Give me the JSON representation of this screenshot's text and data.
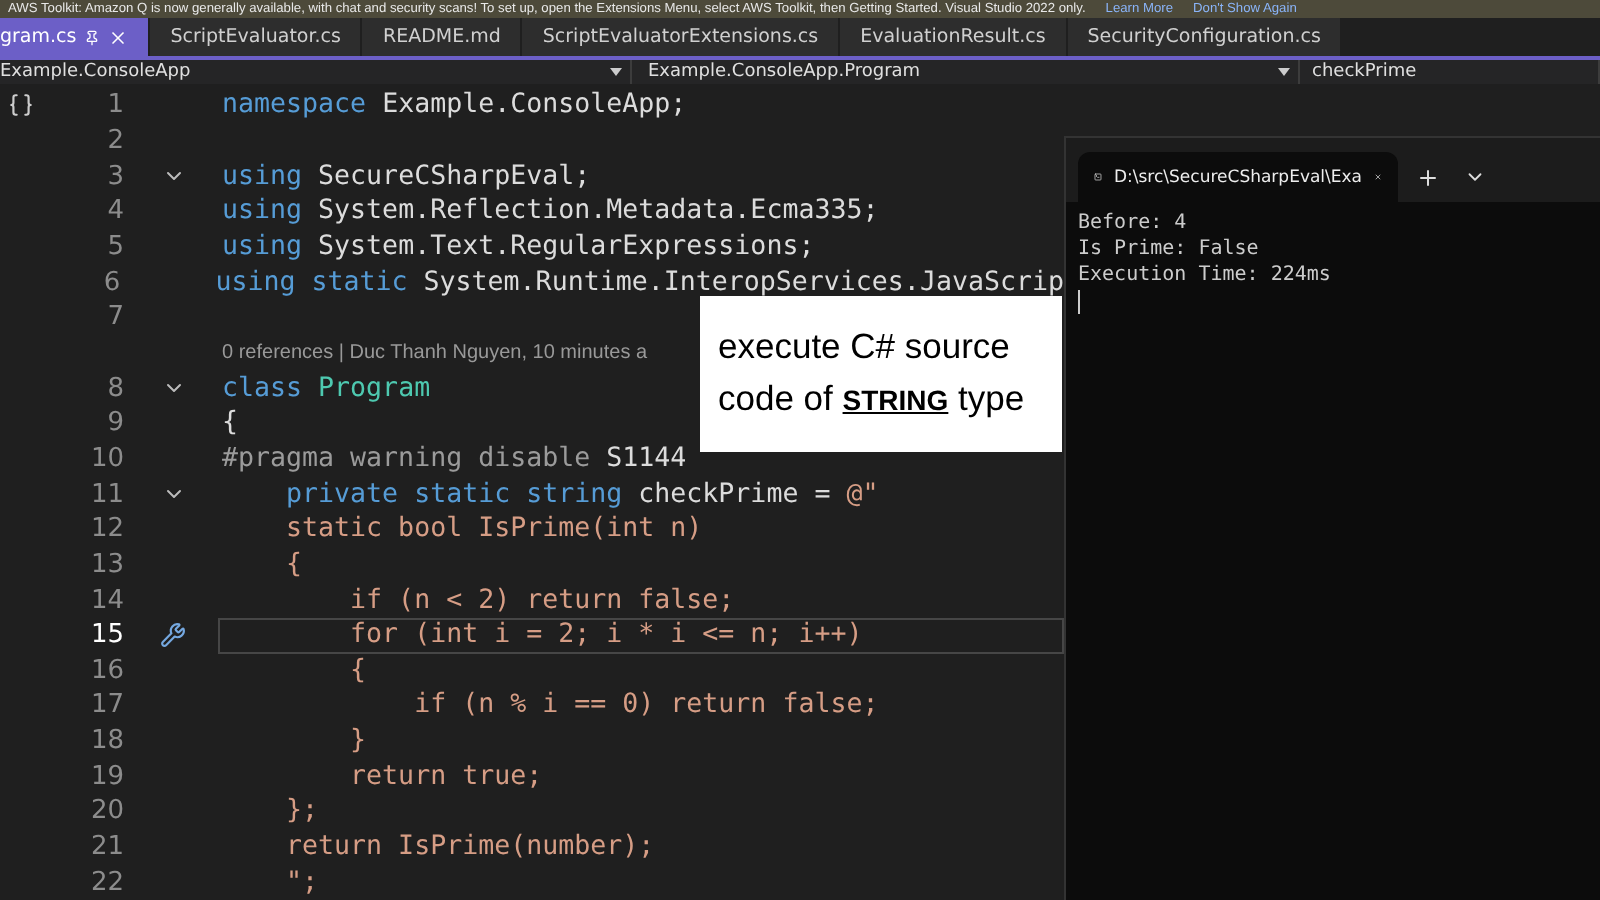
{
  "info_bar": {
    "message": "AWS Toolkit: Amazon Q is now generally available, with chat and security scans! To set up, open the Extensions Menu, select AWS Toolkit, then Getting Started. Visual Studio 2022 only.",
    "links": [
      "Learn More",
      "Don't Show Again"
    ]
  },
  "tabs": [
    {
      "label": "gram.cs",
      "selected": true,
      "pinned": true
    },
    {
      "label": "ScriptEvaluator.cs",
      "selected": false,
      "pinned": false
    },
    {
      "label": "README.md",
      "selected": false,
      "pinned": false
    },
    {
      "label": "ScriptEvaluatorExtensions.cs",
      "selected": false,
      "pinned": false
    },
    {
      "label": "EvaluationResult.cs",
      "selected": false,
      "pinned": false
    },
    {
      "label": "SecurityConfiguration.cs",
      "selected": false,
      "pinned": false
    }
  ],
  "nav_bar": {
    "project": "Example.ConsoleApp",
    "type": "Example.ConsoleApp.Program",
    "member": "checkPrime"
  },
  "editor": {
    "lines": [
      {
        "kind": "code",
        "number": "1",
        "fold": false,
        "current": false,
        "tokens": [
          {
            "kind": "keyword",
            "s": "namespace"
          },
          {
            "kind": "plain",
            "s": " Example.ConsoleApp;"
          }
        ]
      },
      {
        "kind": "code",
        "number": "2",
        "fold": false,
        "current": false
      },
      {
        "kind": "code",
        "number": "3",
        "fold": true,
        "current": false,
        "tokens": [
          {
            "kind": "keyword",
            "s": "using"
          },
          {
            "kind": "plain",
            "s": " SecureCSharpEval;"
          }
        ]
      },
      {
        "kind": "code",
        "number": "4",
        "fold": false,
        "current": false,
        "tokens": [
          {
            "kind": "keyword",
            "s": "using"
          },
          {
            "kind": "plain",
            "s": " System.Reflection.Metadata.Ecma335;"
          }
        ]
      },
      {
        "kind": "code",
        "number": "5",
        "fold": false,
        "current": false,
        "tokens": [
          {
            "kind": "keyword",
            "s": "using"
          },
          {
            "kind": "plain",
            "s": " System.Text.RegularExpressions;"
          }
        ]
      },
      {
        "kind": "code",
        "number": "6",
        "fold": false,
        "current": false,
        "tokens": [
          {
            "kind": "keyword",
            "s": "using static"
          },
          {
            "kind": "plain",
            "s": " System.Runtime.InteropServices.JavaScrip"
          }
        ]
      },
      {
        "kind": "code",
        "number": "7",
        "fold": false,
        "current": false
      },
      {
        "kind": "lens",
        "text": "0 references | Duc Thanh Nguyen, 10 minutes a"
      },
      {
        "kind": "code",
        "number": "8",
        "fold": true,
        "current": false,
        "tokens": [
          {
            "kind": "keyword",
            "s": "class"
          },
          {
            "kind": "type",
            "s": " Program"
          }
        ]
      },
      {
        "kind": "code",
        "number": "9",
        "fold": false,
        "current": false,
        "tokens": [
          {
            "kind": "plain",
            "s": "{"
          }
        ]
      },
      {
        "kind": "code",
        "number": "10",
        "fold": false,
        "current": false,
        "tokens": [
          {
            "kind": "preproc",
            "s": "#pragma warning disable"
          },
          {
            "kind": "plain",
            "s": " S1144"
          }
        ]
      },
      {
        "kind": "code",
        "number": "11",
        "fold": true,
        "current": false,
        "tokens": [
          {
            "kind": "keyword",
            "s": "    private static string"
          },
          {
            "kind": "plain",
            "s": " checkPrime = "
          },
          {
            "kind": "string",
            "s": "@\""
          }
        ]
      },
      {
        "kind": "code",
        "number": "12",
        "fold": false,
        "current": false,
        "tokens": [
          {
            "kind": "string",
            "s": "    static bool IsPrime(int n)"
          }
        ]
      },
      {
        "kind": "code",
        "number": "13",
        "fold": false,
        "current": false,
        "tokens": [
          {
            "kind": "string",
            "s": "    {"
          }
        ]
      },
      {
        "kind": "code",
        "number": "14",
        "fold": false,
        "current": false,
        "tokens": [
          {
            "kind": "string",
            "s": "        if (n < 2) return false;"
          }
        ]
      },
      {
        "kind": "code",
        "number": "15",
        "fold": false,
        "current": true,
        "tokens": [
          {
            "kind": "string",
            "s": "        for (int i = 2; i * i <= n; i++)"
          }
        ]
      },
      {
        "kind": "code",
        "number": "16",
        "fold": false,
        "current": false,
        "tokens": [
          {
            "kind": "string",
            "s": "        {"
          }
        ]
      },
      {
        "kind": "code",
        "number": "17",
        "fold": false,
        "current": false,
        "tokens": [
          {
            "kind": "string",
            "s": "            if (n % i == 0) return false;"
          }
        ]
      },
      {
        "kind": "code",
        "number": "18",
        "fold": false,
        "current": false,
        "tokens": [
          {
            "kind": "string",
            "s": "        }"
          }
        ]
      },
      {
        "kind": "code",
        "number": "19",
        "fold": false,
        "current": false,
        "tokens": [
          {
            "kind": "string",
            "s": "        return true;"
          }
        ]
      },
      {
        "kind": "code",
        "number": "20",
        "fold": false,
        "current": false,
        "tokens": [
          {
            "kind": "string",
            "s": "    };"
          }
        ]
      },
      {
        "kind": "code",
        "number": "21",
        "fold": false,
        "current": false,
        "tokens": [
          {
            "kind": "string",
            "s": "    return IsPrime(number);"
          }
        ]
      },
      {
        "kind": "code",
        "number": "22",
        "fold": false,
        "current": false,
        "tokens": [
          {
            "kind": "string",
            "s": "    \";"
          }
        ]
      }
    ]
  },
  "terminal": {
    "title": "D:\\src\\SecureCSharpEval\\Exa",
    "output": [
      "Before: 4",
      "Is Prime: False",
      "Execution Time: 224ms"
    ]
  },
  "callout": {
    "text": "execute C# source code of **STRING** type"
  }
}
